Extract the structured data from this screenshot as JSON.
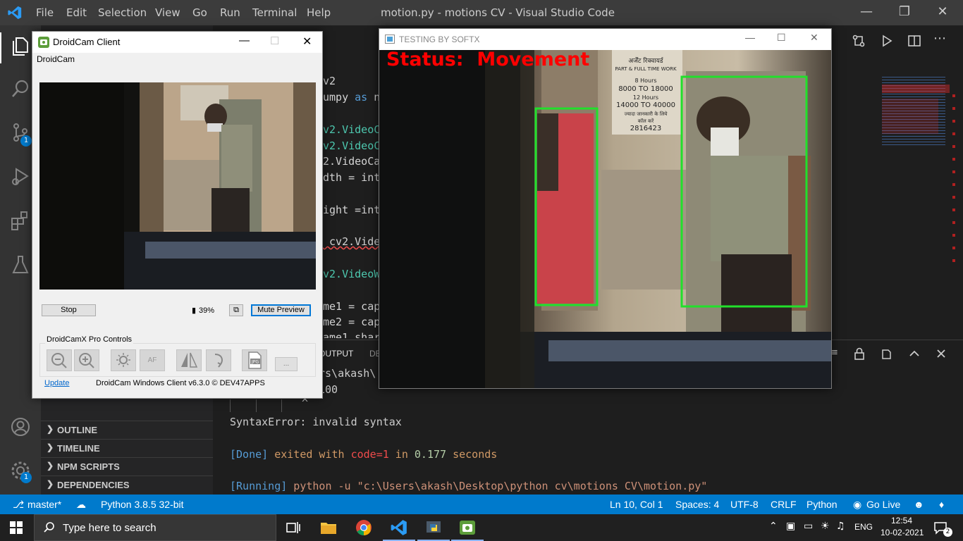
{
  "vscode": {
    "window_title": "motion.py - motions CV - Visual Studio Code",
    "menu": [
      "File",
      "Edit",
      "Selection",
      "View",
      "Go",
      "Run",
      "Terminal",
      "Help"
    ],
    "activity_badges": {
      "source_control": "1",
      "settings": "1"
    },
    "sidebar_sections": [
      "OUTLINE",
      "TIMELINE",
      "NPM SCRIPTS",
      "DEPENDENCIES"
    ],
    "code_lines": [
      {
        "text": "v2",
        "color": "#d4d4d4"
      },
      {
        "text": "umpy as n",
        "color": "#d4d4d4"
      },
      {
        "text": "v2.VideoC",
        "color": "#4ec9b0"
      },
      {
        "text": "v2.VideoC",
        "color": "#4ec9b0"
      },
      {
        "text": "2.VideoCa",
        "color": "#d4d4d4"
      },
      {
        "text": "dth = int",
        "color": "#d4d4d4"
      },
      {
        "text": "ight =int",
        "color": "#d4d4d4"
      },
      {
        "text": " cv2.Vide",
        "color": "#d4d4d4"
      },
      {
        "text": "v2.VideoW",
        "color": "#4ec9b0"
      },
      {
        "text": "me1 = cap",
        "color": "#d4d4d4"
      },
      {
        "text": "me2 = cap",
        "color": "#d4d4d4"
      },
      {
        "text": "ame1 shar",
        "color": "#d4d4d4"
      }
    ],
    "panel_tabs": {
      "output": "OUTPUT",
      "debug": "DE"
    },
    "terminal": {
      "line1": "rs\\akash\\",
      "line2": "100",
      "caret": "^",
      "error": "SyntaxError: invalid syntax",
      "done_tag": "[Done]",
      "done_text": " exited with ",
      "done_code": "code=1",
      "done_in": " in ",
      "done_time": "0.177",
      "done_seconds": " seconds",
      "running_tag": "[Running]",
      "running_cmd": " python -u \"c:\\Users\\akash\\Desktop\\python cv\\motions CV\\motion.py\""
    },
    "statusbar": {
      "branch": "master*",
      "python": "Python 3.8.5 32-bit",
      "position": "Ln 10, Col 1",
      "spaces": "Spaces: 4",
      "encoding": "UTF-8",
      "eol": "CRLF",
      "language": "Python",
      "golive": "Go Live"
    }
  },
  "droidcam": {
    "title": "DroidCam Client",
    "menu_label": "DroidCam",
    "stop_label": "Stop",
    "battery": "39%",
    "mute_label": "Mute Preview",
    "pro_controls": "DroidCamX Pro Controls",
    "af_label": "AF",
    "jpg_label": "JPG",
    "more_label": "...",
    "update_link": "Update",
    "footer": "DroidCam Windows Client v6.3.0 © DEV47APPS"
  },
  "testing": {
    "title": "TESTING BY SOFTX",
    "status_text": "Status:  Movement",
    "poster_lines": [
      "अर्जेंट रिक्वायर्ड",
      "PART & FULL TIME WORK",
      "8 Hours",
      "8000 TO 18000",
      "12 Hours",
      "14000 TO 40000",
      "ज्यादा जानकारी के लिये",
      "कॉल करें",
      "2816423"
    ],
    "box_color": "#21e02b",
    "status_color": "#ff0000"
  },
  "taskbar": {
    "search_placeholder": "Type here to search",
    "language": "ENG",
    "time": "12:54",
    "date": "10-02-2021",
    "notif_count": "2"
  }
}
